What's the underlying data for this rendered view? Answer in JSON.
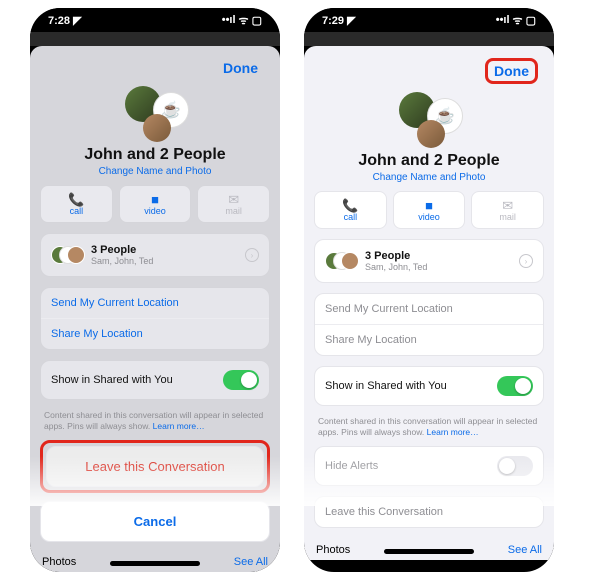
{
  "left": {
    "status": {
      "time": "7:28",
      "loc_icon": "◤",
      "signal": "••ıl",
      "wifi": "ᯤ",
      "battery": "▢"
    },
    "nav": {
      "done": "Done"
    },
    "header": {
      "title": "John and 2 People",
      "subtitle": "Change Name and Photo"
    },
    "actions": {
      "call": {
        "label": "call",
        "icon": "📞"
      },
      "video": {
        "label": "video",
        "icon": "■"
      },
      "mail": {
        "label": "mail",
        "icon": "✉"
      }
    },
    "people": {
      "count_label": "3 People",
      "names": "Sam, John, Ted"
    },
    "options": {
      "send_loc": "Send My Current Location",
      "share_loc": "Share My Location",
      "share_with_you": "Show in Shared with You",
      "info": "Content shared in this conversation will appear in selected apps. Pins will always show. ",
      "learn_more": "Learn more…"
    },
    "leave": "Leave this Conversation",
    "cancel": "Cancel",
    "photos": {
      "header": "Photos",
      "see_all": "See All"
    }
  },
  "right": {
    "status": {
      "time": "7:29",
      "loc_icon": "◤",
      "signal": "••ıl",
      "wifi": "ᯤ",
      "battery": "▢"
    },
    "nav": {
      "done": "Done"
    },
    "header": {
      "title": "John and 2 People",
      "subtitle": "Change Name and Photo"
    },
    "actions": {
      "call": {
        "label": "call",
        "icon": "📞"
      },
      "video": {
        "label": "video",
        "icon": "■"
      },
      "mail": {
        "label": "mail",
        "icon": "✉"
      }
    },
    "people": {
      "count_label": "3 People",
      "names": "Sam, John, Ted"
    },
    "options": {
      "send_loc": "Send My Current Location",
      "share_loc": "Share My Location",
      "share_with_you": "Show in Shared with You",
      "info": "Content shared in this conversation will appear in selected apps. Pins will always show. ",
      "learn_more": "Learn more…",
      "hide_alerts": "Hide Alerts",
      "leave": "Leave this Conversation"
    },
    "photos": {
      "header": "Photos",
      "see_all": "See All"
    }
  }
}
